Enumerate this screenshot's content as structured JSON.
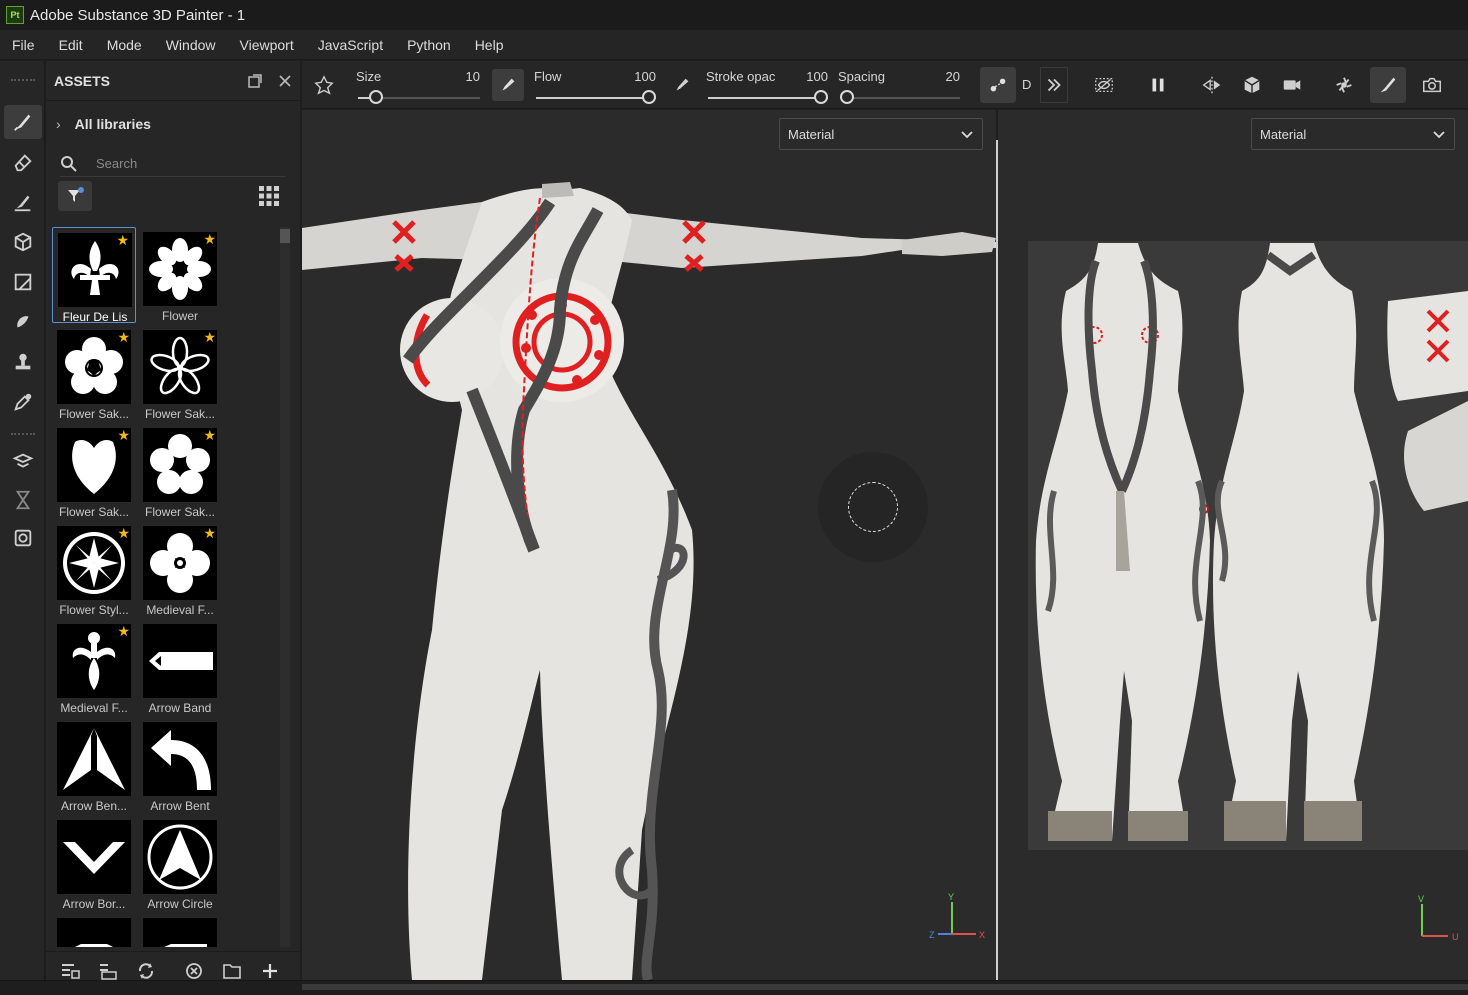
{
  "window": {
    "title": "Adobe Substance 3D Painter - 1",
    "app_badge": "Pt"
  },
  "menu": [
    "File",
    "Edit",
    "Mode",
    "Window",
    "Viewport",
    "JavaScript",
    "Python",
    "Help"
  ],
  "assets": {
    "title": "ASSETS",
    "libraries_label": "All libraries",
    "search_placeholder": "Search",
    "items": [
      {
        "label": "Fleur De Lis",
        "favorite": true,
        "selected": true
      },
      {
        "label": "Flower",
        "favorite": true
      },
      {
        "label": "Flower Sak...",
        "favorite": true
      },
      {
        "label": "Flower Sak...",
        "favorite": true
      },
      {
        "label": "Flower Sak...",
        "favorite": true
      },
      {
        "label": "Flower Sak...",
        "favorite": true
      },
      {
        "label": "Flower Styl...",
        "favorite": true
      },
      {
        "label": "Medieval F...",
        "favorite": true
      },
      {
        "label": "Medieval F...",
        "favorite": true
      },
      {
        "label": "Arrow Band",
        "favorite": false
      },
      {
        "label": "Arrow Ben...",
        "favorite": false
      },
      {
        "label": "Arrow Bent",
        "favorite": false
      },
      {
        "label": "Arrow Bor...",
        "favorite": false
      },
      {
        "label": "Arrow Circle",
        "favorite": false
      }
    ]
  },
  "toolbar": {
    "size": {
      "label": "Size",
      "value": "10",
      "level": 0.1
    },
    "flow": {
      "label": "Flow",
      "value": "100",
      "level": 1.0
    },
    "stroke_opacity": {
      "label": "Stroke opac",
      "value": "100",
      "level": 1.0
    },
    "spacing": {
      "label": "Spacing",
      "value": "20",
      "level": 0.0
    },
    "d_label": "D"
  },
  "viewport3d": {
    "mode": "Material",
    "axes": {
      "y": "Y",
      "x": "X",
      "z": "Z"
    }
  },
  "viewport2d": {
    "mode": "Material",
    "axes": {
      "v": "V",
      "u": "U"
    }
  },
  "colors": {
    "accent": "#5b8fd4",
    "star": "#f2b81f",
    "paint_red": "#e02020"
  }
}
